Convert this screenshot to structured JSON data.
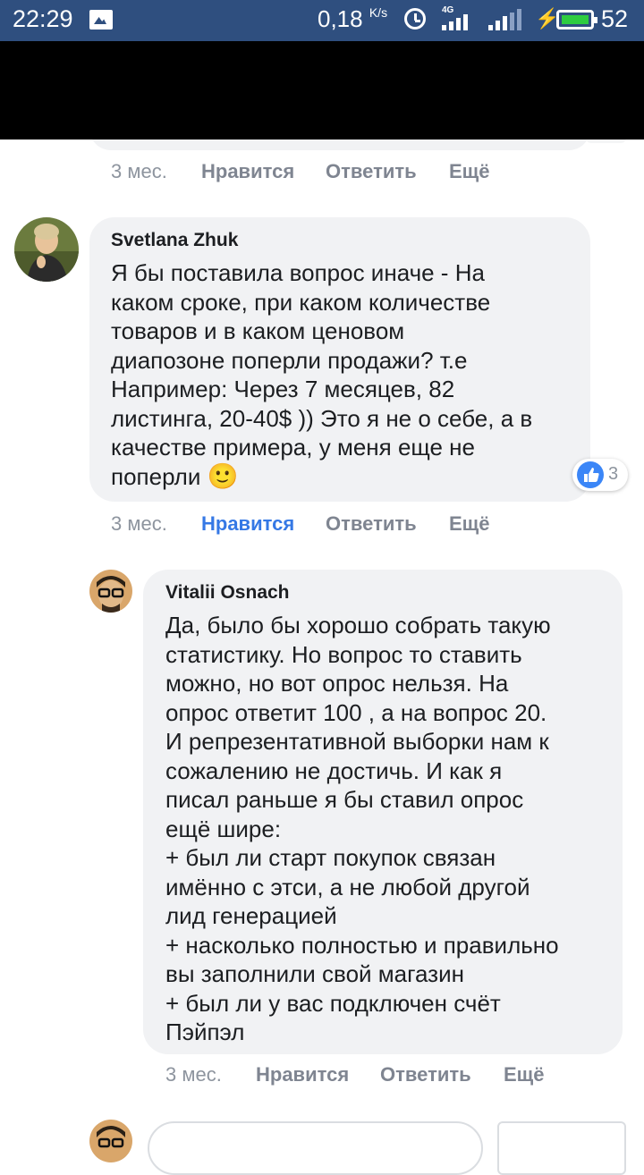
{
  "status_bar": {
    "time": "22:29",
    "speed_value": "0,18",
    "speed_unit": "K/s",
    "network_label": "4G",
    "battery_level": "52",
    "background_color": "#2f4f7f"
  },
  "previous_comment": {
    "meta": {
      "time": "3 мес.",
      "like": "Нравится",
      "reply": "Ответить",
      "more": "Ещё"
    }
  },
  "comments": [
    {
      "author": "Svetlana Zhuk",
      "text": "Я бы поставила вопрос иначе - На\nкаком сроке, при каком количестве\nтоваров и в каком ценовом\nдиапозоне поперли продажи? т.е\nНапример: Через 7 месяцев, 82\nлистинга, 20-40$ )) Это я не о себе, а в\nкачестве примера, у меня еще не\nпоперли",
      "emoji": "🙂",
      "reaction_count": "3",
      "reaction_icon": "like-icon",
      "liked": true,
      "meta": {
        "time": "3 мес.",
        "like": "Нравится",
        "reply": "Ответить",
        "more": "Ещё"
      }
    },
    {
      "author": "Vitalii Osnach",
      "text": "Да, было бы хорошо собрать такую\nстатистику. Но вопрос то ставить\nможно, но вот опрос нельзя. На\nопрос ответит 100 , а на вопрос 20.\nИ репрезентативной выборки нам к\nсожалению не достичь. И как я\nписал раньше я бы ставил опрос\nещё шире:\n+ был ли старт покупок связан\nимённо с этси, а не любой другой\nлид генерацией\n+ насколько полностью и правильно\nвы заполнили свой магазин\n+ был ли у вас подключен счёт\nПэйпэл",
      "meta": {
        "time": "3 мес.",
        "like": "Нравится",
        "reply": "Ответить",
        "more": "Ещё"
      }
    }
  ],
  "colors": {
    "like_active": "#3578e5",
    "meta_grey": "#8d949e",
    "bubble": "#f1f2f4"
  }
}
